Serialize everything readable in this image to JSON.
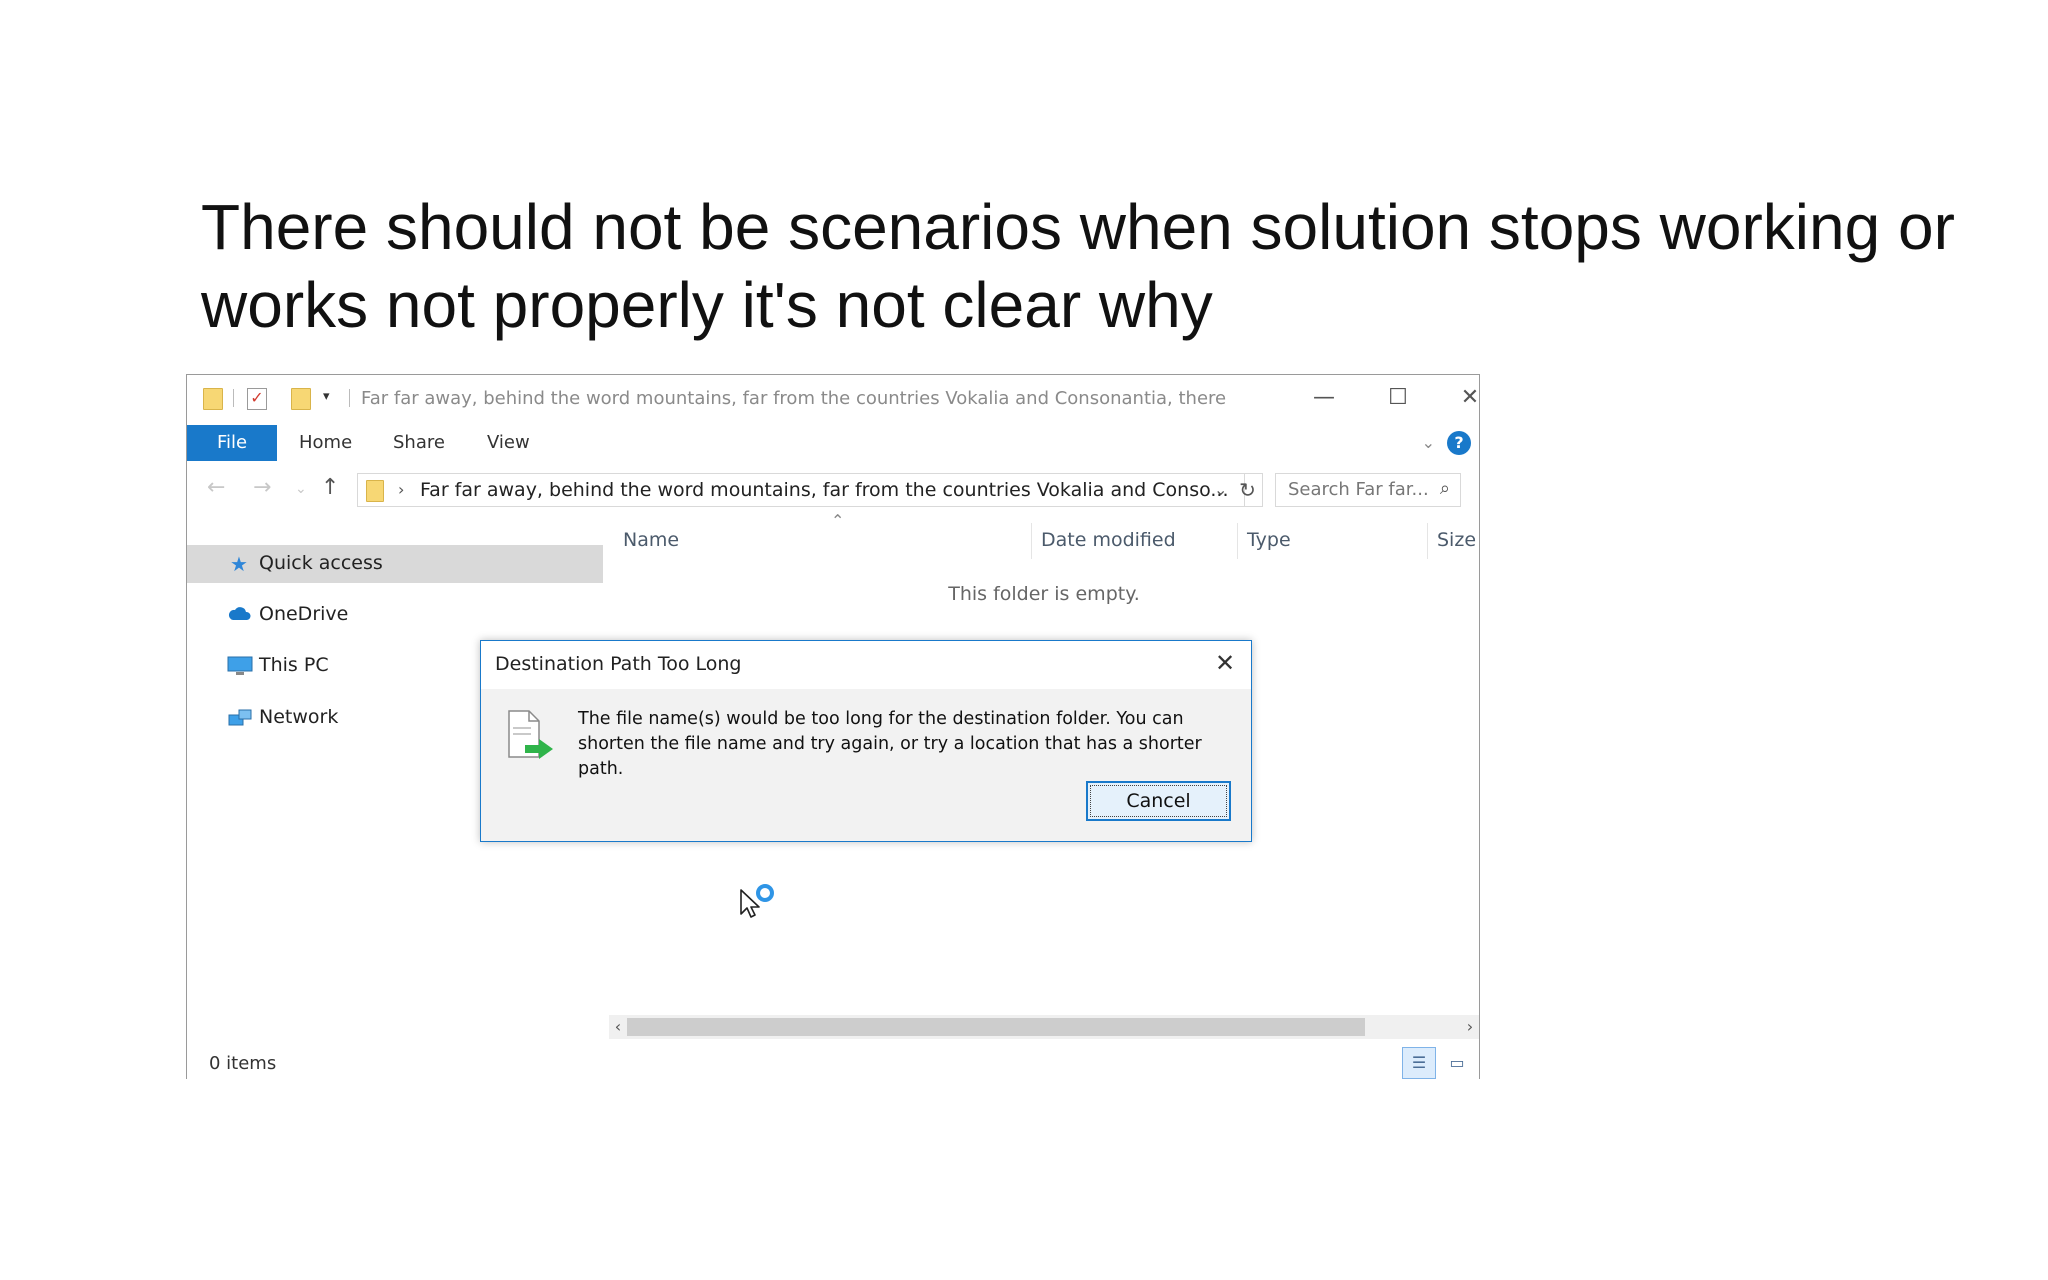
{
  "slide": {
    "title": "There should not be scenarios when solution stops working or works not properly it's not clear why"
  },
  "explorer": {
    "title_bar": {
      "title": "Far far away, behind the word mountains, far from the countries Vokalia and Consonantia, there",
      "minimize_glyph": "—",
      "maximize_glyph": "☐",
      "close_glyph": "✕"
    },
    "ribbon": {
      "tabs": [
        {
          "label": "File",
          "active": true
        },
        {
          "label": "Home"
        },
        {
          "label": "Share"
        },
        {
          "label": "View"
        }
      ],
      "help_glyph": "?"
    },
    "address_bar": {
      "path": "Far far away, behind the word mountains, far from the countries Vokalia and Conso...",
      "separator": "›"
    },
    "search": {
      "placeholder": "Search Far far..."
    },
    "nav_pane": {
      "items": [
        {
          "label": "Quick access",
          "icon": "star-icon",
          "selected": true
        },
        {
          "label": "OneDrive",
          "icon": "cloud-icon"
        },
        {
          "label": "This PC",
          "icon": "computer-icon"
        },
        {
          "label": "Network",
          "icon": "network-icon"
        }
      ]
    },
    "content": {
      "columns": [
        "Name",
        "Date modified",
        "Type",
        "Size"
      ],
      "empty_message": "This folder is empty."
    },
    "status_bar": {
      "item_count": "0 items"
    },
    "colors": {
      "accent": "#1979ca",
      "selection": "#d9d9d9"
    }
  },
  "dialog": {
    "title": "Destination Path Too Long",
    "message": "The file name(s) would be too long for the destination folder. You can shorten the file name and try again, or try a location that has a shorter path.",
    "cancel_label": "Cancel",
    "icon": "file-move-icon"
  }
}
